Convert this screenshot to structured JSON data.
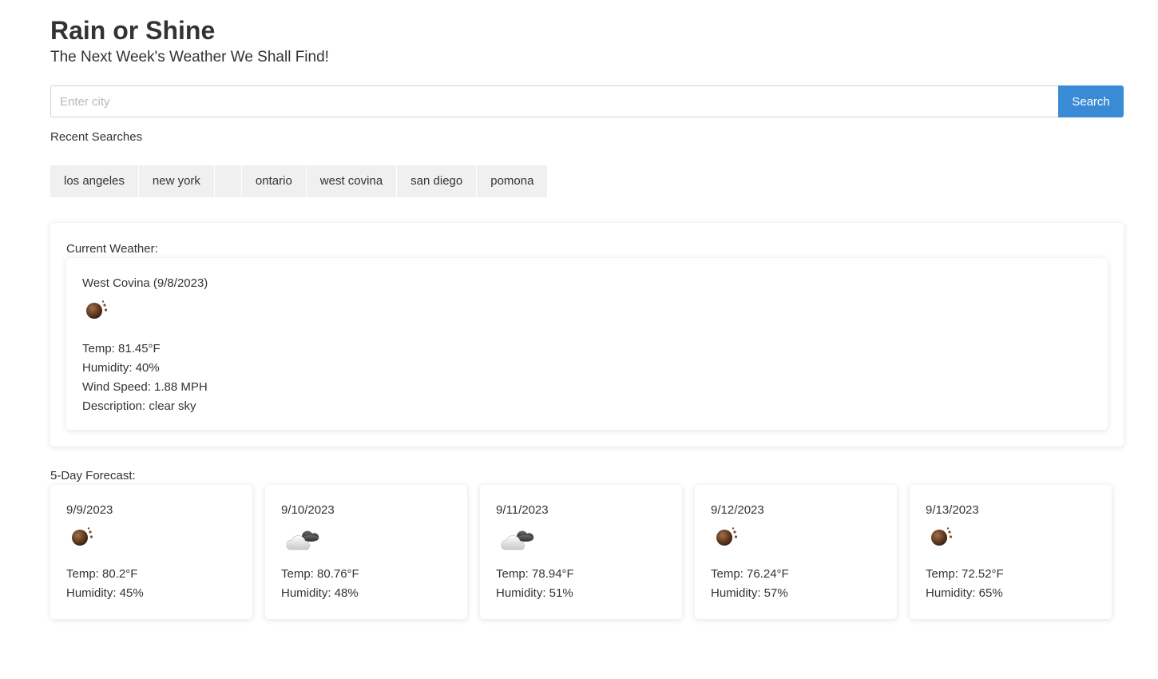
{
  "header": {
    "title": "Rain or Shine",
    "subtitle": "The Next Week's Weather We Shall Find!"
  },
  "search": {
    "placeholder": "Enter city",
    "value": "",
    "button_label": "Search"
  },
  "recent": {
    "label": "Recent Searches",
    "items": [
      "los angeles",
      "new york",
      "",
      "ontario",
      "west covina",
      "san diego",
      "pomona"
    ]
  },
  "current": {
    "label": "Current Weather:",
    "city_date": "West Covina (9/8/2023)",
    "icon": "clear-sky-icon",
    "temp": "Temp: 81.45°F",
    "humidity": "Humidity: 40%",
    "wind": "Wind Speed: 1.88 MPH",
    "description": "Description: clear sky"
  },
  "forecast": {
    "label": "5-Day Forecast:",
    "days": [
      {
        "date": "9/9/2023",
        "icon": "clear-sky-icon",
        "temp": "Temp: 80.2°F",
        "humidity": "Humidity: 45%"
      },
      {
        "date": "9/10/2023",
        "icon": "cloudy-icon",
        "temp": "Temp: 80.76°F",
        "humidity": "Humidity: 48%"
      },
      {
        "date": "9/11/2023",
        "icon": "cloudy-icon",
        "temp": "Temp: 78.94°F",
        "humidity": "Humidity: 51%"
      },
      {
        "date": "9/12/2023",
        "icon": "clear-sky-icon",
        "temp": "Temp: 76.24°F",
        "humidity": "Humidity: 57%"
      },
      {
        "date": "9/13/2023",
        "icon": "clear-sky-icon",
        "temp": "Temp: 72.52°F",
        "humidity": "Humidity: 65%"
      }
    ]
  },
  "colors": {
    "accent": "#3a8bd6",
    "recent_bg": "#f0f0f0",
    "text": "#333333"
  }
}
